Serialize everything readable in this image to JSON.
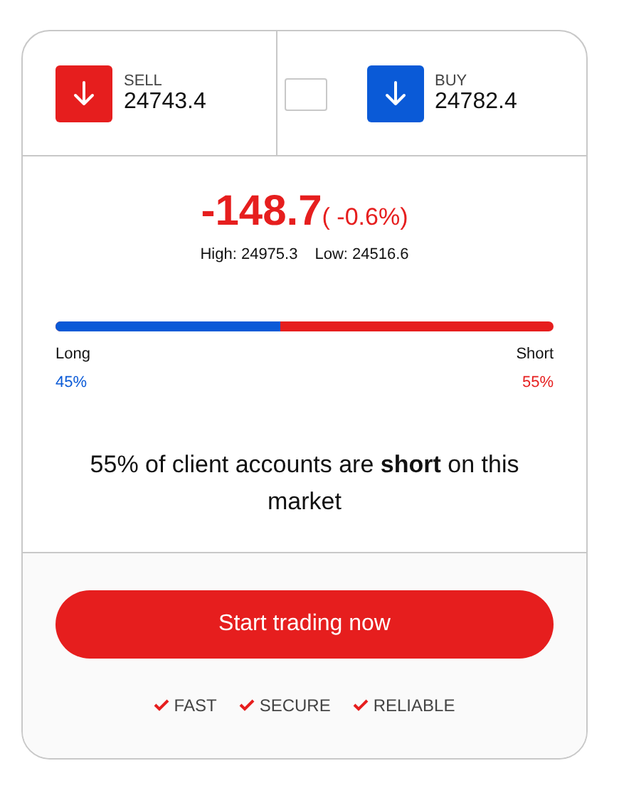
{
  "quotes": [
    {
      "label": "SELL",
      "price": "24743.4",
      "color": "#e61e1e"
    },
    {
      "label": "BUY",
      "price": "24782.4",
      "color": "#0a5ad7"
    }
  ],
  "change": {
    "value": "-148.7",
    "percent": "( -0.6%)",
    "high": "High: 24975.3",
    "low": "Low: 24516.6"
  },
  "sentiment": {
    "level": 0.45,
    "long_label": "Long",
    "long_value": "45%",
    "short_label": "Short",
    "short_value": "55%"
  },
  "summary": "55% of client accounts are **short** on this market",
  "cta": {
    "label": "Start trading now"
  },
  "features": [
    "FAST",
    "SECURE",
    "RELIABLE"
  ]
}
